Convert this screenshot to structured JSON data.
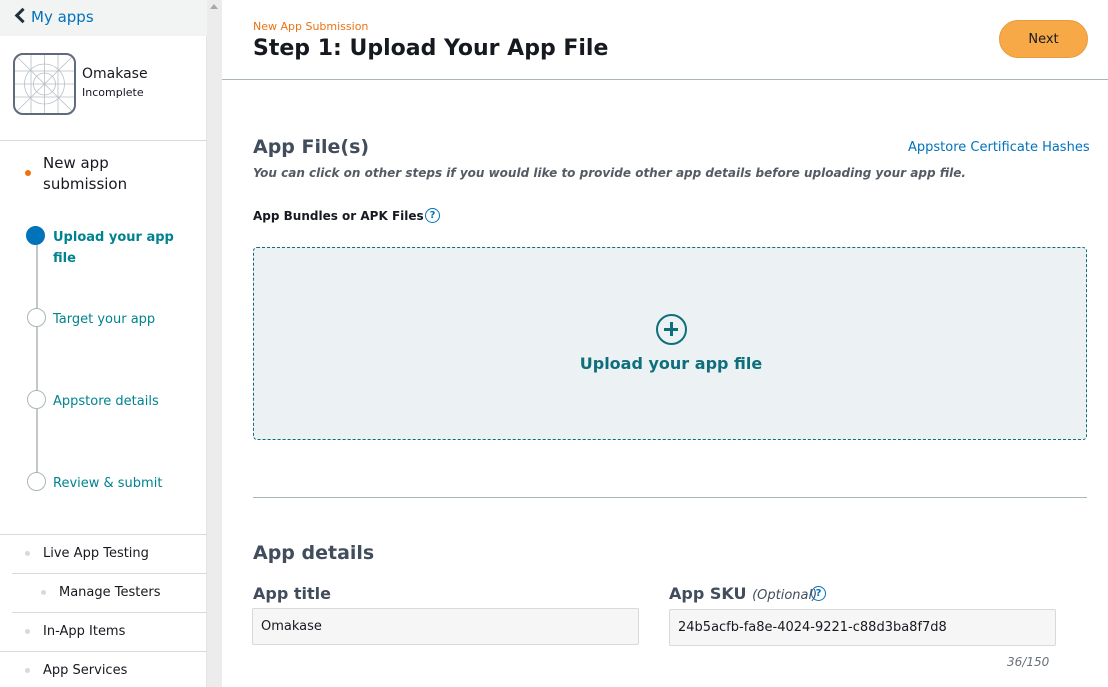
{
  "sidebar": {
    "back_label": "My apps",
    "app_name": "Omakase",
    "app_status": "Incomplete",
    "group_title": "New app submission",
    "steps": [
      {
        "label": "Upload your app file",
        "state": "active"
      },
      {
        "label": "Target your app",
        "state": "pending"
      },
      {
        "label": "Appstore details",
        "state": "pending"
      },
      {
        "label": "Review & submit",
        "state": "pending"
      }
    ],
    "nav": [
      {
        "label": "Live App Testing"
      },
      {
        "label": "Manage Testers"
      },
      {
        "label": "In-App Items"
      },
      {
        "label": "App Services"
      }
    ]
  },
  "header": {
    "eyebrow": "New App Submission",
    "title": "Step 1: Upload Your App File",
    "next_label": "Next"
  },
  "app_files": {
    "title": "App File(s)",
    "cert_link": "Appstore Certificate Hashes",
    "hint": "You can click on other steps if you would like to provide other app details before uploading your app file.",
    "bundles_label": "App Bundles or APK Files",
    "upload_label": "Upload your app file"
  },
  "app_details": {
    "title": "App details",
    "app_title_label": "App title",
    "app_title_value": "Omakase",
    "sku_label": "App SKU",
    "sku_optional": "(Optional)",
    "sku_value": "24b5acfb-fa8e-4024-9221-c88d3ba8f7d8",
    "sku_counter": "36/150"
  },
  "colors": {
    "accent_orange": "#ec7211",
    "next_button": "#f7a847",
    "link_blue": "#0073bb",
    "teal": "#0f6e7b",
    "dropzone_bg": "#ecf2f3"
  }
}
